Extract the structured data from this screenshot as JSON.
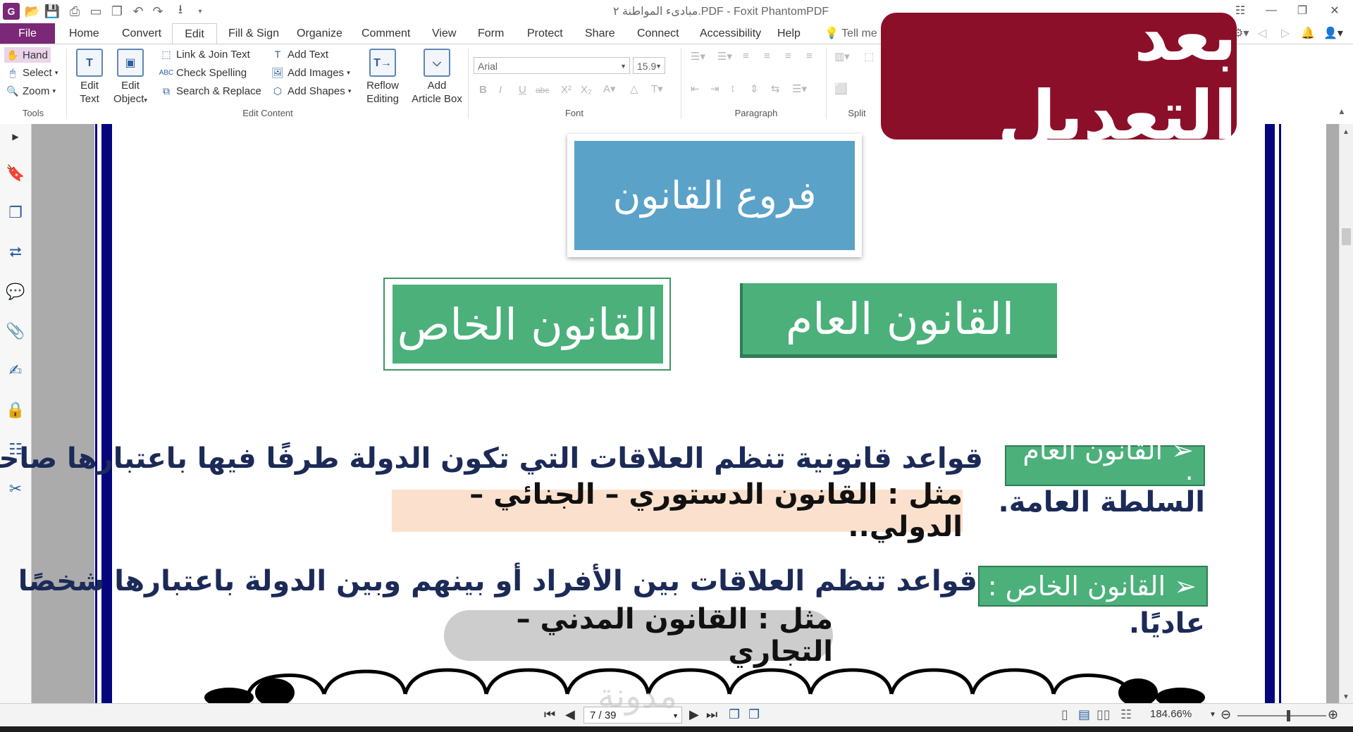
{
  "window": {
    "title": "مبادىء المواطنة ٢.PDF - Foxit PhantomPDF"
  },
  "tabs": [
    "File",
    "Home",
    "Convert",
    "Edit",
    "Fill & Sign",
    "Organize",
    "Comment",
    "View",
    "Form",
    "Protect",
    "Share",
    "Connect",
    "Accessibility",
    "Help"
  ],
  "tell_me": "Tell me",
  "ribbon": {
    "tools": {
      "hand": "Hand",
      "select": "Select",
      "zoom": "Zoom",
      "group": "Tools"
    },
    "edit_content": {
      "edit_text_1": "Edit",
      "edit_text_2": "Text",
      "edit_object_1": "Edit",
      "edit_object_2": "Object",
      "link_join": "Link & Join Text",
      "check_spelling": "Check Spelling",
      "search_replace": "Search & Replace",
      "add_text": "Add Text",
      "add_images": "Add Images",
      "add_shapes": "Add Shapes",
      "reflow_1": "Reflow",
      "reflow_2": "Editing",
      "article_1": "Add",
      "article_2": "Article Box",
      "group": "Edit Content"
    },
    "font": {
      "family": "Arial",
      "size": "15.9",
      "group": "Font"
    },
    "paragraph": {
      "group": "Paragraph"
    },
    "split": {
      "group": "Split"
    }
  },
  "document": {
    "title_box": "فروع القانون",
    "branch_public": "القانون العام",
    "branch_private": "القانون الخاص",
    "public_label": "➢ القانون العام :",
    "public_text_1": "قواعد قانونية تنظم العلاقات التي تكون الدولة طرفًا فيها باعتبارها صاحبة",
    "public_text_2": "السلطة العامة.",
    "public_example": "مثل : القانون الدستوري – الجنائي – الدولي..",
    "private_label": "➢ القانون الخاص :",
    "private_text_1": "قواعد تنظم العلاقات بين الأفراد أو بينهم وبين الدولة باعتبارها شخصًا",
    "private_text_2": "عاديًا.",
    "private_example": "مثل : القانون المدني – التجاري"
  },
  "status": {
    "page": "7 / 39",
    "zoom": "184.66%"
  },
  "overlay": {
    "banner": "بعد التعديل",
    "watermark": "مدونة"
  },
  "colors": {
    "file_tab": "#7a2877",
    "banner": "#8c0f29",
    "title_box": "#5ba2c9",
    "branch_green": "#4bb07a",
    "page_border": "#05057d",
    "body_text": "#1b2a57"
  }
}
